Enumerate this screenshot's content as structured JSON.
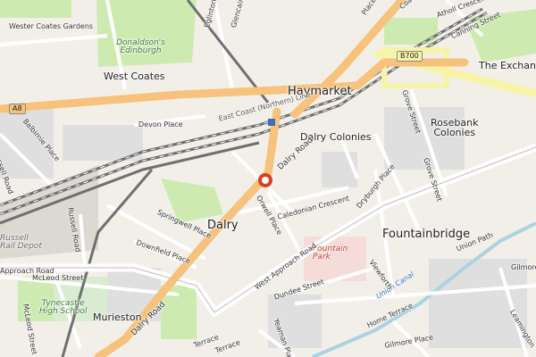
{
  "map": {
    "areas": {
      "haymarket": "Haymarket",
      "dalry": "Dalry",
      "fountainbridge": "Fountainbridge",
      "west_coates": "West Coates",
      "dalry_colonies": "Dalry Colonies",
      "rosebank_colonies": "Rosebank\nColonies",
      "the_exchange": "The Exchange",
      "murieston": "Murieston"
    },
    "streets": {
      "dalry_road_top": "Dalry Road",
      "dalry_road_bottom": "Dalry Road",
      "west_approach_road_right": "West Approach Road",
      "west_approach_road_left": "Approach Road",
      "caledonian_crescent": "Caledonian Crescent",
      "orwell_place": "Orwell Place",
      "springwell_place": "Springwell Place",
      "downfield_place": "Downfield Place",
      "devon_place": "Devon Place",
      "wester_coates_gardens": "Wester Coates Gardens",
      "balbirnie_place": "Balbirnie Place",
      "russell_road": "Russell Road",
      "russell_road_left": "ssell Road",
      "mcleod_street": "McLeod Street",
      "mcleod_street_left": "McLeod Street",
      "dundee_street": "Dundee Street",
      "viewforth": "Viewforth",
      "dryburgh_place": "Dryburgh Place",
      "grove_street": "Grove Street",
      "grove_street_2": "Grove Street",
      "union_path": "Union Path",
      "gilmore": "Gilmore",
      "gilmore_place": "Gilmore Place",
      "home_terrace": "Home Terrace",
      "yeaman_place": "Yeaman Place",
      "leamington": "Leamington",
      "canning_street": "Canning Street",
      "atholl_crescent": "Atholl Crescent",
      "glencairn_crescent": "Glencairn Crescent",
      "eglinton": "Eglinton",
      "terrace_1": "Terrace",
      "terrace_2": "Terrace",
      "coates": "Coates",
      "place": "Place"
    },
    "railway": {
      "east_coast": "East Coast (Northern) Line"
    },
    "water": {
      "union_canal": "Union Canal"
    },
    "parks": {
      "donaldsons": "Donaldson's\nEdinburgh",
      "fountain_park": "Fountain\nPark",
      "russell_depot": "Russell\nRail Depot",
      "tynecastle": "Tynecastle\nHigh School"
    },
    "shields": {
      "a8": "A8",
      "b700": "B700"
    },
    "colors": {
      "primary_road": "#f6c27c",
      "secondary_road": "#f7f4a8",
      "railway": "#6f6f6f",
      "water": "#aad3df",
      "park": "#cdebb0",
      "marker": "#d9411e"
    }
  }
}
